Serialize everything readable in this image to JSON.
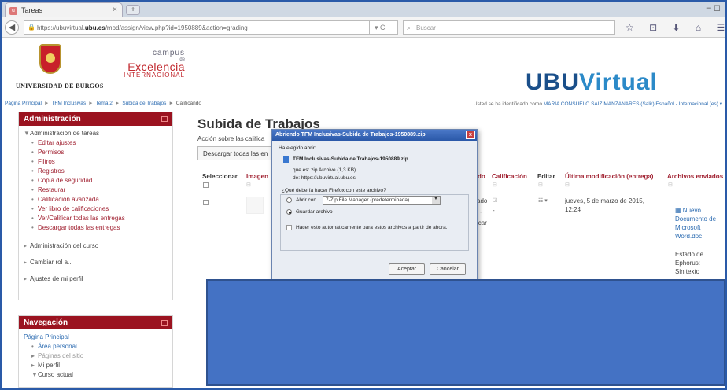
{
  "browser": {
    "tab_title": "Tareas",
    "tab_close": "×",
    "new_tab": "+",
    "url_prefix": "https://ubuvirtual.",
    "url_domain": "ubu.es",
    "url_rest": "/mod/assign/view.php?id=1950889&action=grading",
    "search_placeholder": "Buscar",
    "window_controls": "– ◻",
    "nav_icons": "☆ ⊡ ⬇ ⌂ ☰"
  },
  "header": {
    "university": "UNIVERSIDAD DE BURGOS",
    "campus_1": "campus",
    "campus_2": "de",
    "campus_3": "Excelencia",
    "campus_4": "INTERNACIONAL",
    "ubu_1": "UBU",
    "ubu_2": "Virtual"
  },
  "breadcrumb": {
    "items": [
      "Página Principal",
      "TFM Inclusivas",
      "Tema 2",
      "Subida de Trabajos",
      "Calificando"
    ],
    "separator": "►"
  },
  "userline": {
    "prefix": "Usted se ha identificado como ",
    "user": "MARIA CONSUELO SAIZ MANZANARES (Salir)",
    "lang": " Español - Internacional (es) ▾"
  },
  "admin_block": {
    "title": "Administración",
    "root": "Administración de tareas",
    "items": [
      "Editar ajustes",
      "Permisos",
      "Filtros",
      "Registros",
      "Copia de seguridad",
      "Restaurar",
      "Calificación avanzada",
      "Ver libro de calificaciones",
      "Ver/Calificar todas las entregas",
      "Descargar todas las entregas"
    ],
    "sections": [
      "Administración del curso",
      "Cambiar rol a...",
      "Ajustes de mi perfil"
    ]
  },
  "nav_block": {
    "title": "Navegación",
    "home": "Página Principal",
    "items": [
      "Área personal",
      "Páginas del sitio",
      "Mi perfil",
      "Curso actual"
    ]
  },
  "main": {
    "title": "Subida de Trabajos",
    "accion_label": "Acción sobre las califica",
    "download_select": "Descargar todas las en",
    "columns": [
      "Seleccionar",
      "Imagen",
      "do",
      "Calificación",
      "Editar",
      "Última modificación (entrega)",
      "Archivos enviados"
    ],
    "row": {
      "status": "ado",
      "dash": "-",
      "status2": "icar",
      "date": "jueves, 5 de marzo de 2015, 12:24",
      "file": "Nuevo Documento de Microsoft Word.doc",
      "ephorus": "Estado de Ephorus:",
      "notext": "Sin texto"
    }
  },
  "dialog": {
    "title": "Abriendo TFM Inclusivas-Subida de Trabajos-1950889.zip",
    "close": "x",
    "intro": "Ha elegido abrir:",
    "filename": "TFM Inclusivas-Subida de Trabajos-1950889.zip",
    "type": "que es: zip Archive (1,3 KB)",
    "from": "de: https://ubuvirtual.ubu.es",
    "question": "¿Qué debería hacer Firefox con este archivo?",
    "open_with": "Abrir con",
    "app": "7-Zip File Manager (predeterminada)",
    "save": "Guardar archivo",
    "auto": "Hacer esto automáticamente para estos archivos a partir de ahora.",
    "ok": "Aceptar",
    "cancel": "Cancelar"
  },
  "colors": {
    "accent": "#9b1320",
    "link": "#2a6ab0",
    "overlay": "#4472c4"
  }
}
